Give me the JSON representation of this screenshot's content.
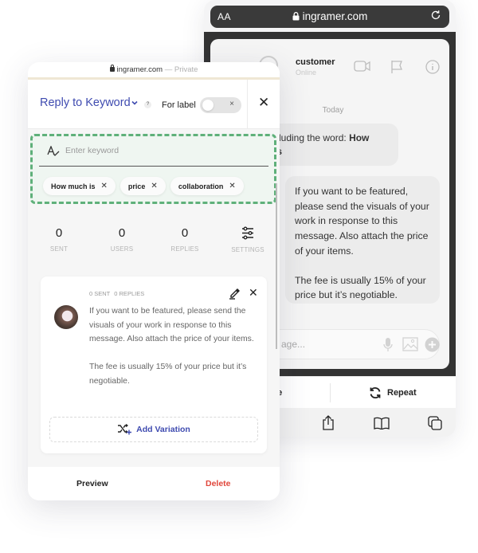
{
  "colors": {
    "brand": "#3f4bb0",
    "keyword_border": "#5fb07a",
    "delete": "#e0473c",
    "safari_bar": "#3a3a3a"
  },
  "phone": {
    "address_bar": {
      "text_size_label": "AA",
      "url": "ingramer.com",
      "lock_icon": "lock-icon",
      "reload_icon": "reload-icon"
    },
    "chat": {
      "contact_name": "customer",
      "contact_status": "Online",
      "header_icons": [
        "back-icon",
        "avatar",
        "video-call-icon",
        "flag-icon",
        "info-icon"
      ],
      "date_label": "Today",
      "incoming_message": {
        "visible_prefix": "including the word: ",
        "keyword": "How is"
      },
      "incoming_line1": "cluding the word: ",
      "incoming_bold1": "How",
      "incoming_line2": "is",
      "outgoing_message": {
        "paragraph1": "If you want to be featured, please send the visuals of your work in response to this message. Also attach the price of your items.",
        "paragraph2": "The fee is usually 15% of your price but it’s negotiable."
      },
      "input_placeholder": "age...",
      "input_icons": [
        "microphone-icon",
        "image-icon",
        "plus-circle-icon"
      ]
    },
    "actions": {
      "left_label": "se",
      "repeat_label": "Repeat"
    },
    "toolbar_icons": [
      "share-icon",
      "bookmarks-icon",
      "tabs-icon"
    ]
  },
  "panel": {
    "url_bar": {
      "url": "ingramer.com",
      "mode": "— Private"
    },
    "header": {
      "title": "Reply to Keyword",
      "help": "?",
      "for_label": "For label",
      "toggle_on": false,
      "toggle_x": "×",
      "close": "✕"
    },
    "keyword_input": {
      "placeholder": "Enter keyword",
      "value": ""
    },
    "keywords": [
      {
        "label": "How much is"
      },
      {
        "label": "price"
      },
      {
        "label": "collaboration"
      }
    ],
    "stats": [
      {
        "value": "0",
        "label": "SENT"
      },
      {
        "value": "0",
        "label": "USERS"
      },
      {
        "value": "0",
        "label": "REPLIES"
      },
      {
        "value": "",
        "label": "SETTINGS"
      }
    ],
    "reply": {
      "sent": "0 SENT",
      "replies": "0 REPLIES",
      "paragraph1": "If you want to be featured, please send the visuals of your work in response to this message. Also attach the price of your items.",
      "paragraph2": "The fee is usually 15% of your price but it’s negotiable.",
      "close": "✕",
      "add_variation": "Add Variation"
    },
    "footer": {
      "preview": "Preview",
      "delete": "Delete"
    }
  }
}
